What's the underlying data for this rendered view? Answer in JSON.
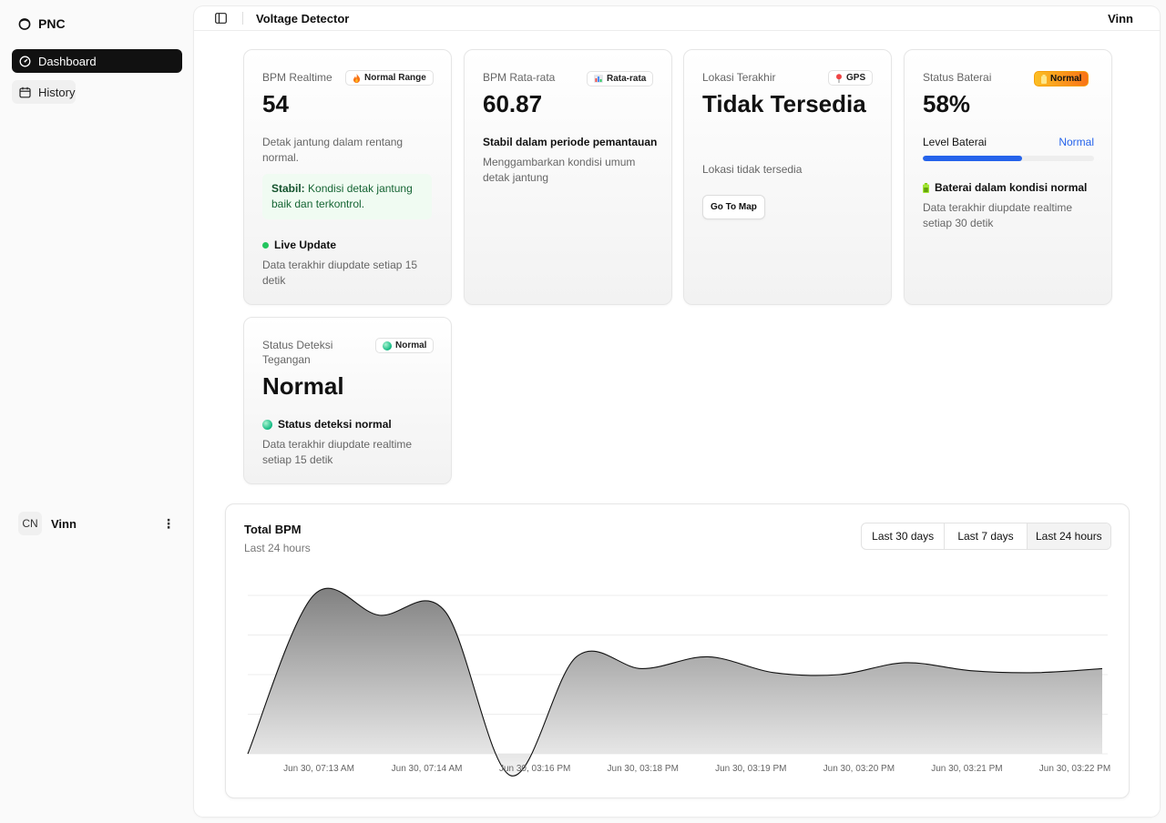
{
  "sidebar": {
    "brand": "PNC",
    "items": [
      {
        "label": "Dashboard",
        "icon": "gauge-icon",
        "active": true
      },
      {
        "label": "History",
        "icon": "calendar-icon",
        "active": false
      }
    ],
    "user": {
      "initials": "CN",
      "name": "Vinn"
    }
  },
  "header": {
    "title": "Voltage Detector",
    "user": "Vinn"
  },
  "cards": {
    "bpm_realtime": {
      "label": "BPM Realtime",
      "badge": "Normal Range",
      "badge_icon": "fire-icon",
      "value": "54",
      "desc": "Detak jantung dalam rentang normal.",
      "note_bold": "Stabil:",
      "note_text": "Kondisi detak jantung baik dan terkontrol.",
      "live": "Live Update",
      "footer": "Data terakhir diupdate setiap 15 detik"
    },
    "bpm_avg": {
      "label": "BPM Rata-rata",
      "badge": "Rata-rata",
      "badge_icon": "bar-chart-icon",
      "value": "60.87",
      "bold": "Stabil dalam periode pemantauan",
      "desc": "Menggambarkan kondisi umum detak jantung"
    },
    "location": {
      "label": "Lokasi Terakhir",
      "badge": "GPS",
      "badge_icon": "pin-icon",
      "value": "Tidak Tersedia",
      "desc": "Lokasi tidak tersedia",
      "button": "Go To Map"
    },
    "battery": {
      "label": "Status Baterai",
      "badge": "Normal",
      "badge_icon": "battery-icon",
      "value": "58%",
      "level_label": "Level Baterai",
      "level_status": "Normal",
      "level_fraction": 0.58,
      "bold": "Baterai dalam kondisi normal",
      "desc": "Data terakhir diupdate realtime setiap 30 detik",
      "colors": {
        "fill": "#2563eb",
        "badge_from": "#fbbf24",
        "badge_to": "#f97316"
      }
    },
    "voltage": {
      "label": "Status Deteksi Tegangan",
      "badge": "Normal",
      "badge_icon": "green-sphere-icon",
      "value": "Normal",
      "bold": "Status deteksi normal",
      "desc": "Data terakhir diupdate realtime setiap 15 detik"
    }
  },
  "chart": {
    "title": "Total BPM",
    "subtitle": "Last 24 hours",
    "ranges": [
      "Last 30 days",
      "Last 7 days",
      "Last 24 hours"
    ],
    "selected_range": "Last 24 hours"
  },
  "chart_data": {
    "type": "area",
    "title": "Total BPM",
    "x": [
      "Jun 30, 07:13 AM",
      "Jun 30, 07:14 AM",
      "Jun 30, 03:16 PM",
      "Jun 30, 03:18 PM",
      "Jun 30, 03:19 PM",
      "Jun 30, 03:20 PM",
      "Jun 30, 03:21 PM",
      "Jun 30, 03:22 PM"
    ],
    "series": [
      {
        "values": [
          0,
          400,
          350,
          360,
          -55,
          245,
          215,
          245,
          205,
          200,
          230,
          210,
          205,
          215
        ]
      }
    ],
    "ylim": [
      0,
      400
    ],
    "grid": true,
    "legend": "none"
  }
}
